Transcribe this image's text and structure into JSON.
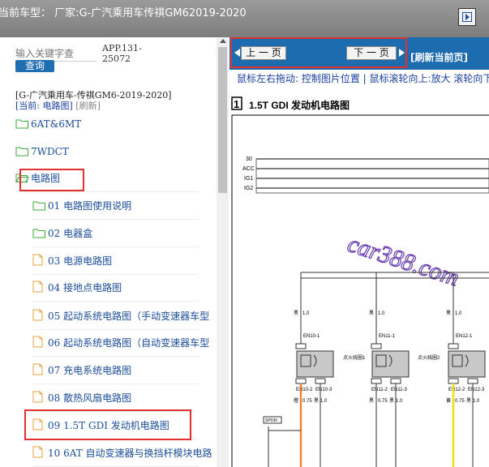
{
  "header": {
    "title": "当前车型：  厂家:G-广汽乘用车传祺GM62019-2020",
    "exit_icon": "exit-icon"
  },
  "sidebar": {
    "search_placeholder": "输入关键字查",
    "app_code": [
      "APP.131-",
      "25072"
    ],
    "query_label": "查询",
    "car_model": "[G-广汽乘用车-传祺GM6-2019-2020]",
    "current_label": "[当前: 电路图]",
    "refresh_label": "[刷新]",
    "items": [
      {
        "label": "6AT&6MT",
        "icon": "folder"
      },
      {
        "label": "7WDCT",
        "icon": "folder"
      },
      {
        "label": "电路图",
        "icon": "folder-open"
      },
      {
        "label": "01 电路图使用说明",
        "icon": "folder"
      },
      {
        "label": "02 电器盒",
        "icon": "folder"
      },
      {
        "label": "03 电源电路图",
        "icon": "document"
      },
      {
        "label": "04 接地点电路图",
        "icon": "document"
      },
      {
        "label": "05 起动系统电路图（手动变速器车型",
        "icon": "document"
      },
      {
        "label": "06 起动系统电路图（自动变速器车型",
        "icon": "document"
      },
      {
        "label": "07 充电系统电路图",
        "icon": "document"
      },
      {
        "label": "08 散热风扇电路图",
        "icon": "document"
      },
      {
        "label": "09 1.5T GDI 发动机电路图",
        "icon": "document"
      },
      {
        "label": "10 6AT 自动变速器与换挡杆模块电路",
        "icon": "document"
      }
    ]
  },
  "viewer": {
    "prev_label": "上 一 页",
    "next_label": "下 一 页",
    "refresh_label": "[刷新当前页]",
    "hint": "鼠标左右拖动: 控制图片位置 | 鼠标滚轮向上:放大   滚轮向下",
    "diagram": {
      "page_number": "1",
      "title": "1.5T GDI 发动机电路图",
      "bus_labels": [
        "30",
        "ACC",
        "IG1",
        "IG2"
      ],
      "watermark": "car388.com",
      "fuse_labels": [
        "EN10-1",
        "EN11-1",
        "EN12-1"
      ],
      "wire_size": "1.0",
      "wire_colors": [
        "黑",
        "黑",
        "黑",
        "橙",
        "黑",
        "黑",
        "黑",
        "黄",
        "黑"
      ],
      "coil_labels": [
        "点火线圈1",
        "点火线圈2"
      ],
      "pin_labels": [
        "EN10-2",
        "EN10-3",
        "EN11-2",
        "EN11-3",
        "EN12-2",
        "EN12-3"
      ],
      "small_sizes": [
        "0.75",
        "1.0"
      ],
      "splice_label": "SP036"
    }
  },
  "colors": {
    "accent_blue": "#1e6cb0",
    "highlight_red": "#e03030",
    "wire_orange": "#f08030",
    "wire_yellow": "#f0e020"
  }
}
